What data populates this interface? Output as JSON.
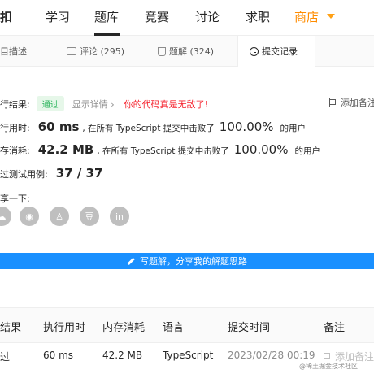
{
  "topnav": {
    "logo": "扣",
    "items": [
      "学习",
      "题库",
      "竞赛",
      "讨论",
      "求职",
      "商店"
    ],
    "active": "题库"
  },
  "tabs": [
    {
      "label": "目描述",
      "icon": "document-icon"
    },
    {
      "label": "评论 (295)",
      "icon": "comment-icon"
    },
    {
      "label": "题解 (324)",
      "icon": "flask-icon"
    },
    {
      "label": "提交记录",
      "icon": "clock-icon",
      "active": true
    }
  ],
  "result": {
    "status_label": "行结果:",
    "status_value": "通过",
    "detail_link": "显示详情 ›",
    "praise": "你的代码真是无敌了!",
    "add_note": "添加备注",
    "runtime_label": "行用时:",
    "runtime_value": "60 ms",
    "runtime_mid": ", 在所有 TypeScript 提交中击败了",
    "runtime_pct": "100.00%",
    "runtime_tail": "的用户",
    "memory_label": "存消耗:",
    "memory_value": "42.2 MB",
    "memory_mid": ", 在所有 TypeScript 提交中击败了",
    "memory_pct": "100.00%",
    "memory_tail": "的用户",
    "tests_label": "过测试用例:",
    "tests_value": "37 / 37",
    "share_label": "享一下:"
  },
  "share_icons": [
    {
      "name": "cloud-icon",
      "glyph": "☁"
    },
    {
      "name": "weibo-icon",
      "glyph": "◉"
    },
    {
      "name": "qq-icon",
      "glyph": "♙"
    },
    {
      "name": "douban-icon",
      "glyph": "豆"
    },
    {
      "name": "linkedin-icon",
      "glyph": "in"
    }
  ],
  "solution_bar": {
    "label": "写题解，分享我的解题思路"
  },
  "table": {
    "headers": [
      "结果",
      "执行用时",
      "内存消耗",
      "语言",
      "提交时间",
      "备注"
    ],
    "rows": [
      {
        "result": "过",
        "runtime": "60 ms",
        "memory": "42.2 MB",
        "language": "TypeScript",
        "time": "2023/02/28 00:19",
        "note": "添加备注"
      }
    ]
  },
  "watermark": "@稀土掘金技术社区",
  "colors": {
    "accent_blue": "#1a90ff",
    "success_green": "#2db55d",
    "shop_orange": "#ff8c00",
    "praise_red": "#f5222d"
  }
}
